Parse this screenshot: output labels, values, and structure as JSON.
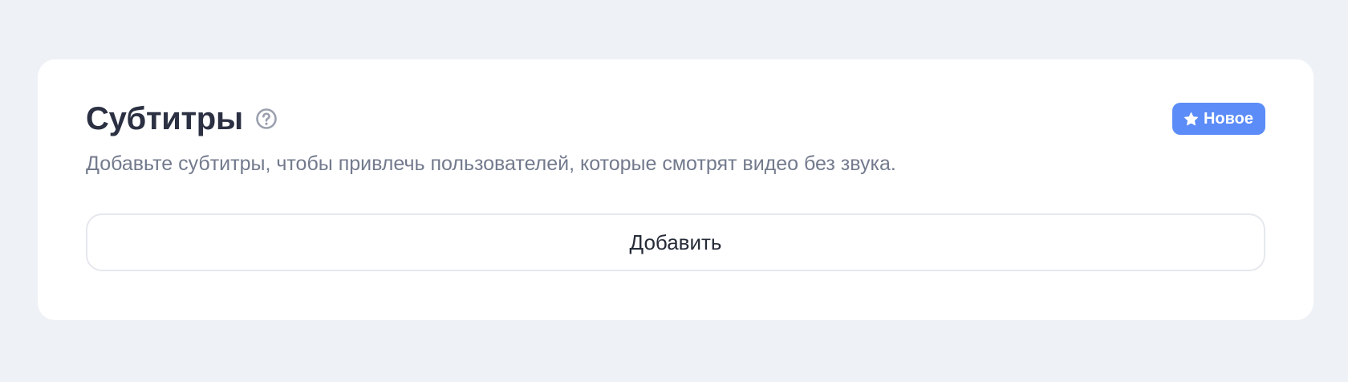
{
  "card": {
    "title": "Субтитры",
    "help_icon": "question-circle-icon",
    "badge": {
      "label": "Новое",
      "icon": "star-icon",
      "color": "#5c8cf7"
    },
    "description": "Добавьте субтитры, чтобы привлечь пользователей, которые смотрят видео без звука.",
    "add_button_label": "Добавить"
  },
  "colors": {
    "background": "#eef1f6",
    "card": "#ffffff",
    "title": "#2b3042",
    "description": "#737a8d",
    "accent": "#5c8cf7"
  }
}
